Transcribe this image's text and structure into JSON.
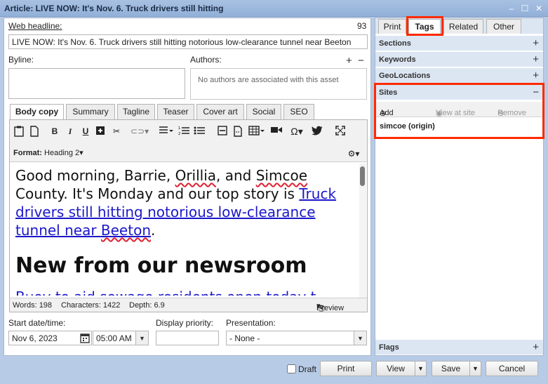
{
  "window": {
    "title": "Article: LIVE NOW: It's Nov. 6. Truck drivers still hitting"
  },
  "headline": {
    "label": "Web headline:",
    "count": "93",
    "value": "LIVE NOW: It's Nov. 6. Truck drivers still hitting notorious low-clearance tunnel near Beeton"
  },
  "byline": {
    "label": "Byline:",
    "value": ""
  },
  "authors": {
    "label": "Authors:",
    "empty_text": "No authors are associated with this asset"
  },
  "editor_tabs": [
    "Body copy",
    "Summary",
    "Tagline",
    "Teaser",
    "Cover art",
    "Social",
    "SEO"
  ],
  "editor": {
    "format_label": "Format:",
    "format_value": "Heading 2",
    "content": {
      "p1_a": "Good morning, Barrie, ",
      "p1_orillia": "Orillia",
      "p1_b": ", and ",
      "p1_simcoe": "Simcoe",
      "p1_c": " County. It's Monday and our top story is ",
      "p1_link_a": "Truck drivers still hitting notorious low-clearance tunnel near ",
      "p1_link_beeton": "Beeton",
      "p1_end": ".",
      "heading": "New from our newsroom",
      "next_line": "Buoy to aid sewage residents open today t"
    },
    "status": {
      "words": "Words: 198",
      "characters": "Characters: 1422",
      "depth": "Depth: 6.9",
      "preview": "Preview"
    }
  },
  "schedule": {
    "start_label": "Start date/time:",
    "date": "Nov 6, 2023",
    "time": "05:00 AM",
    "priority_label": "Display priority:",
    "priority_value": "",
    "presentation_label": "Presentation:",
    "presentation_value": "- None -"
  },
  "right_tabs": [
    "Print",
    "Tags",
    "Related",
    "Other"
  ],
  "right_active_tab": "Tags",
  "sections": {
    "sections": "Sections",
    "keywords": "Keywords",
    "geolocations": "GeoLocations",
    "sites": "Sites",
    "flags": "Flags"
  },
  "sites_toolbar": {
    "add": "Add",
    "view": "View at site",
    "remove": "Remove"
  },
  "sites_list": [
    "simcoe (origin)"
  ],
  "footer": {
    "draft": "Draft",
    "print": "Print",
    "view": "View",
    "save": "Save",
    "cancel": "Cancel"
  },
  "colors": {
    "window_bg": "#b7cbe6",
    "section_bg": "#dce6f3",
    "link": "#1b17c9",
    "highlight": "#ff2a00"
  }
}
